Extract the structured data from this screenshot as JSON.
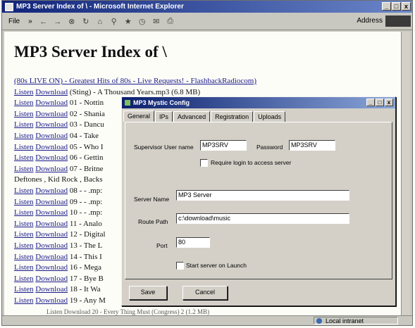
{
  "browser": {
    "title": "MP3 Server Index of \\ - Microsoft Internet Explorer",
    "window_controls": [
      "_",
      "□",
      "x"
    ],
    "menu_file": "File",
    "menu_more": "»",
    "address_label": "Address",
    "status_zone": "Local intranet"
  },
  "page": {
    "heading": "MP3 Server Index of \\",
    "radio_link": "(80s LIVE ON) - Greatest Hits of 80s - Live Requests! - FlashbackRadiocom)",
    "listen_label": "Listen",
    "download_label": "Download",
    "entries": [
      "(Sting) - A Thousand Years.mp3 (6.8 MB)",
      "01 - Nottin",
      "02 - Shania",
      "03 - Dancu",
      "04 - Take",
      "05 - Who I",
      "06 - Gettin",
      "07 - Britne"
    ],
    "plain_line": "Deftones , Kid Rock , Backs",
    "entries2": [
      "08 - - .mp:",
      "09 - - .mp:",
      "10 - - .mp:",
      "11 - Analo",
      "12 - Digital",
      "13 - The L",
      "14 - This I",
      "16 - Mega",
      "17 - Bye B",
      "18 - It Wa",
      "19 - Any M"
    ],
    "bottom_fragment": "Listen Download 20 - Every Thing Must (Congress) 2 (1.2 MB)"
  },
  "dialog": {
    "title": "MP3 Mystic Config",
    "tabs": [
      "General",
      "IPs",
      "Advanced",
      "Registration",
      "Uploads"
    ],
    "supervisor_label": "Supervisor User name",
    "supervisor_value": "MP3SRV",
    "password_label": "Password",
    "password_value": "MP3SRV",
    "require_login_label": "Require login to access server",
    "server_name_label": "Server Name",
    "server_name_value": "MP3 Server",
    "route_path_label": "Route Path",
    "route_path_value": "c:\\download\\music",
    "port_label": "Port",
    "port_value": "80",
    "start_on_launch_label": "Start server on Launch",
    "save_label": "Save",
    "cancel_label": "Cancel"
  }
}
